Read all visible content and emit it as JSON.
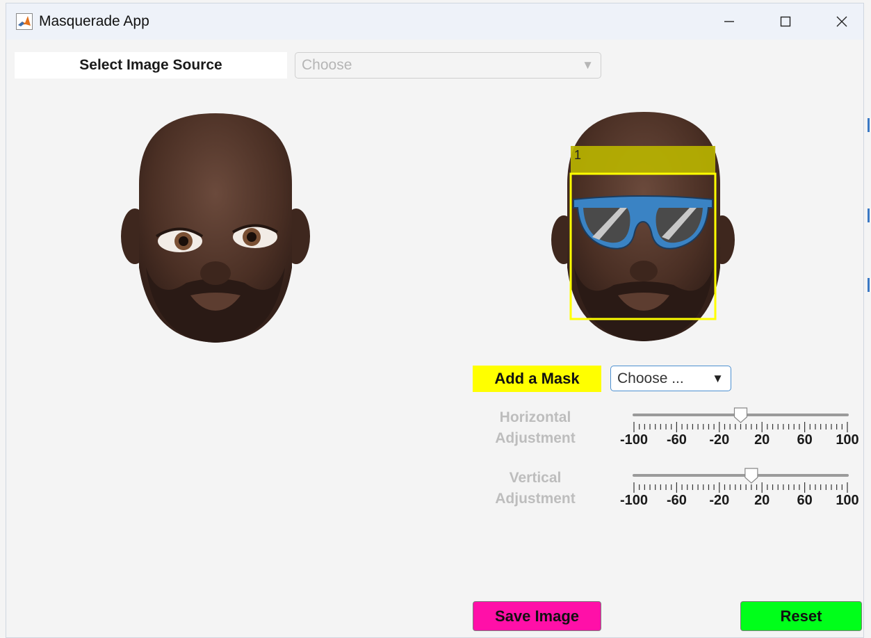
{
  "window": {
    "title": "Masquerade App"
  },
  "source": {
    "label": "Select Image Source",
    "dropdown_value": "Choose"
  },
  "detection": {
    "box_label": "1"
  },
  "mask": {
    "label": "Add a Mask",
    "dropdown_value": "Choose ...",
    "highlight_color": "#ffff00"
  },
  "horizontal": {
    "label_line1": "Horizontal",
    "label_line2": "Adjustment",
    "value": 0,
    "min": -100,
    "max": 100,
    "ticks": [
      "-100",
      "-60",
      "-20",
      "20",
      "60",
      "100"
    ]
  },
  "vertical": {
    "label_line1": "Vertical",
    "label_line2": "Adjustment",
    "value": 10,
    "min": -100,
    "max": 100,
    "ticks": [
      "-100",
      "-60",
      "-20",
      "20",
      "60",
      "100"
    ]
  },
  "buttons": {
    "save_label": "Save Image",
    "save_color": "#ff10a8",
    "reset_label": "Reset",
    "reset_color": "#00ff1a"
  }
}
